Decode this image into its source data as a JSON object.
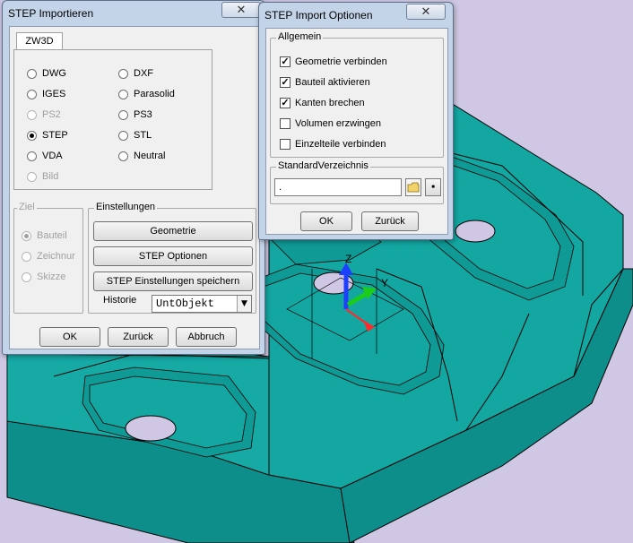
{
  "viewport": {
    "axis_labels": {
      "z": "Z",
      "y": "Y"
    },
    "colors": {
      "background": "#cfc7e3",
      "part_top": "#14a7a2",
      "part_side": "#0e8e8a",
      "edge": "#000000",
      "axis_z": "#1f3fff",
      "axis_y": "#1bcc1b",
      "axis_x": "#ff2a2a"
    }
  },
  "import_dialog": {
    "title": "STEP Importieren",
    "close_glyph": "✕",
    "tab_label": "ZW3D",
    "formats": [
      {
        "label": "DWG",
        "selected": false,
        "disabled": false
      },
      {
        "label": "DXF",
        "selected": false,
        "disabled": false
      },
      {
        "label": "IGES",
        "selected": false,
        "disabled": false
      },
      {
        "label": "Parasolid",
        "selected": false,
        "disabled": false
      },
      {
        "label": "PS2",
        "selected": false,
        "disabled": true
      },
      {
        "label": "PS3",
        "selected": false,
        "disabled": false
      },
      {
        "label": "STEP",
        "selected": true,
        "disabled": false
      },
      {
        "label": "STL",
        "selected": false,
        "disabled": false
      },
      {
        "label": "VDA",
        "selected": false,
        "disabled": false
      },
      {
        "label": "Neutral",
        "selected": false,
        "disabled": false
      },
      {
        "label": "Bild",
        "selected": false,
        "disabled": true
      }
    ],
    "target_group_label": "Ziel",
    "targets": [
      {
        "label": "Bauteil",
        "selected": true
      },
      {
        "label": "Zeichnur",
        "selected": false
      },
      {
        "label": "Skizze",
        "selected": false
      }
    ],
    "settings_group_label": "Einstellungen",
    "btn_geometry": "Geometrie",
    "btn_step_options": "STEP Optionen",
    "btn_save_settings": "STEP Einstellungen speichern",
    "history_label": "Historie",
    "history_value": "UntObjekt",
    "btn_ok": "OK",
    "btn_back": "Zurück",
    "btn_cancel": "Abbruch"
  },
  "options_dialog": {
    "title": "STEP Import Optionen",
    "close_glyph": "✕",
    "general_group_label": "Allgemein",
    "options": [
      {
        "label": "Geometrie verbinden",
        "checked": true
      },
      {
        "label": "Bauteil aktivieren",
        "checked": true
      },
      {
        "label": "Kanten brechen",
        "checked": true
      },
      {
        "label": "Volumen erzwingen",
        "checked": false
      },
      {
        "label": "Einzelteile verbinden",
        "checked": false
      }
    ],
    "std_dir_group_label": "StandardVerzeichnis",
    "std_dir_value": ".",
    "folder_icon": "folder-icon",
    "dot_button_glyph": "■",
    "btn_ok": "OK",
    "btn_back": "Zurück"
  }
}
